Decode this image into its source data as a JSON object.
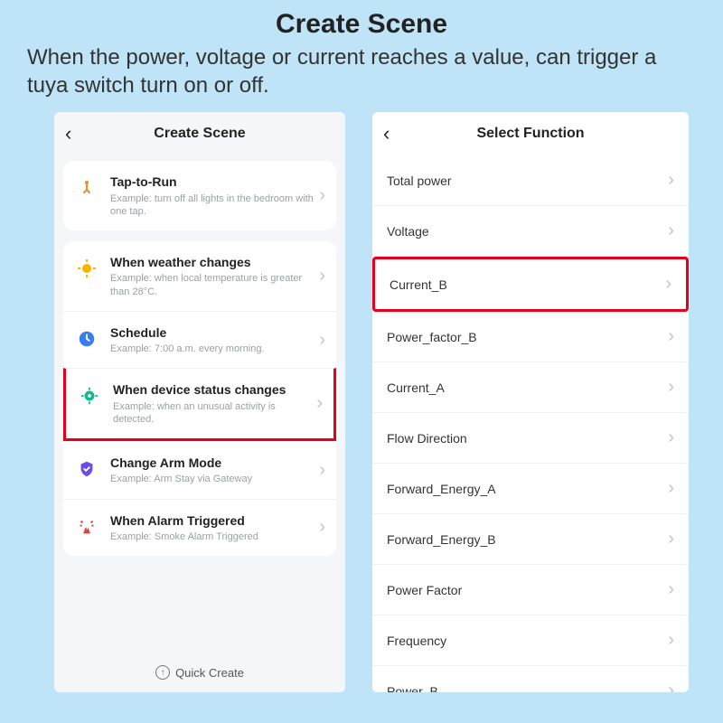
{
  "page_title": "Create Scene",
  "subtitle": "When the power, voltage or current reaches a value, can trigger a tuya switch turn on or off.",
  "left": {
    "header": "Create Scene",
    "items": [
      {
        "icon": "tap-icon",
        "title": "Tap-to-Run",
        "desc": "Example: turn off all lights in the bedroom with one tap.",
        "hl": false
      },
      {
        "icon": "weather-icon",
        "title": "When weather changes",
        "desc": "Example: when local temperature is greater than 28°C.",
        "hl": false
      },
      {
        "icon": "schedule-icon",
        "title": "Schedule",
        "desc": "Example: 7:00 a.m. every morning.",
        "hl": false
      },
      {
        "icon": "device-icon",
        "title": "When device status changes",
        "desc": "Example: when an unusual activity is detected.",
        "hl": true
      },
      {
        "icon": "arm-icon",
        "title": "Change Arm Mode",
        "desc": "Example: Arm Stay via Gateway",
        "hl": false
      },
      {
        "icon": "alarm-icon",
        "title": "When Alarm Triggered",
        "desc": "Example: Smoke Alarm Triggered",
        "hl": false
      }
    ],
    "quick": "Quick Create"
  },
  "right": {
    "header": "Select Function",
    "items": [
      {
        "label": "Total power",
        "hl": false
      },
      {
        "label": "Voltage",
        "hl": false
      },
      {
        "label": "Current_B",
        "hl": true
      },
      {
        "label": "Power_factor_B",
        "hl": false
      },
      {
        "label": "Current_A",
        "hl": false
      },
      {
        "label": "Flow Direction",
        "hl": false
      },
      {
        "label": "Forward_Energy_A",
        "hl": false
      },
      {
        "label": "Forward_Energy_B",
        "hl": false
      },
      {
        "label": "Power Factor",
        "hl": false
      },
      {
        "label": "Frequency",
        "hl": false
      },
      {
        "label": "Power_B",
        "hl": false
      }
    ]
  }
}
